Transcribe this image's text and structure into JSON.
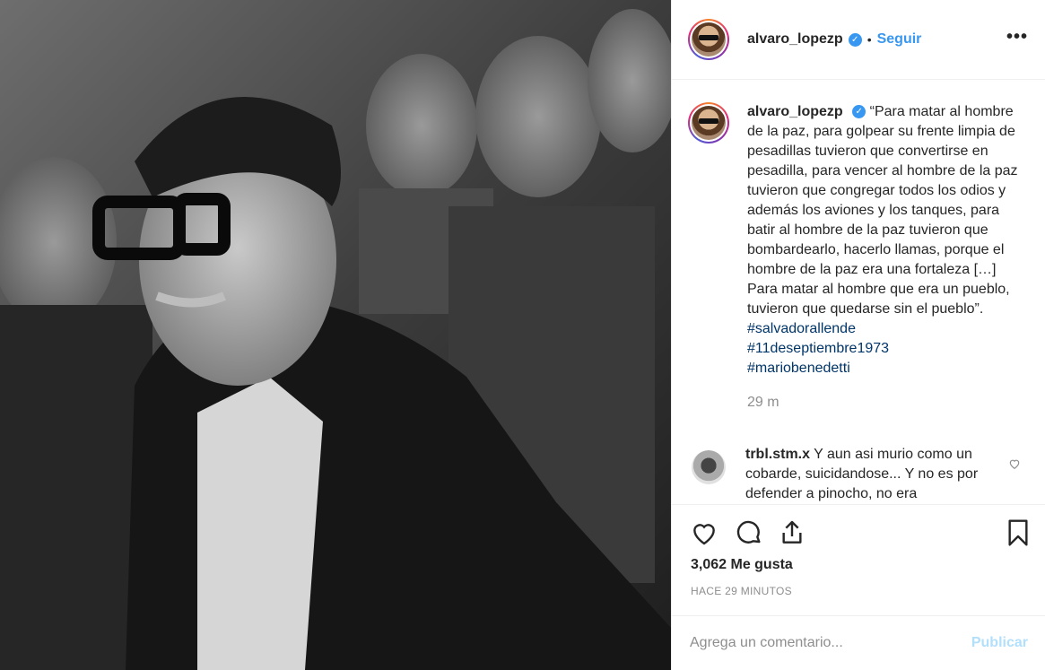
{
  "post": {
    "author": "alvaro_lopezp",
    "follow_label": "Seguir",
    "separator": "•",
    "more_label": "•••"
  },
  "caption": {
    "username": "alvaro_lopezp",
    "text": "“Para matar al hombre de la paz, para golpear su frente limpia de pesadillas tuvieron que convertirse en pesadilla, para vencer al hombre de la paz tuvieron que congregar todos los odios y además los aviones y los tanques, para batir al hombre de la paz tuvieron que bombardearlo, hacerlo llamas, porque el hombre de la paz era una fortaleza […] Para matar al hombre que era un pueblo, tuvieron que quedarse sin el pueblo”. ",
    "hashtags": [
      "#salvadorallende",
      "#11deseptiembre1973",
      "#mariobenedetti"
    ],
    "time": "29 m"
  },
  "comment": {
    "username": "trbl.stm.x",
    "text": "Y aun asi murio como un cobarde, suicidandose... Y no es por defender a pinocho, no era"
  },
  "likes_label": "3,062 Me gusta",
  "posted_label": "HACE 29 MINUTOS",
  "comment_box": {
    "placeholder": "Agrega un comentario...",
    "publish_label": "Publicar"
  },
  "icons": {
    "like": "heart-icon",
    "comment": "comment-bubble-icon",
    "share": "share-icon",
    "save": "bookmark-icon",
    "verified": "verified-badge-icon"
  },
  "colors": {
    "link": "#3897f0",
    "hashtag": "#003569",
    "muted": "#8e8e8e",
    "publish_disabled": "#b2dffc"
  }
}
